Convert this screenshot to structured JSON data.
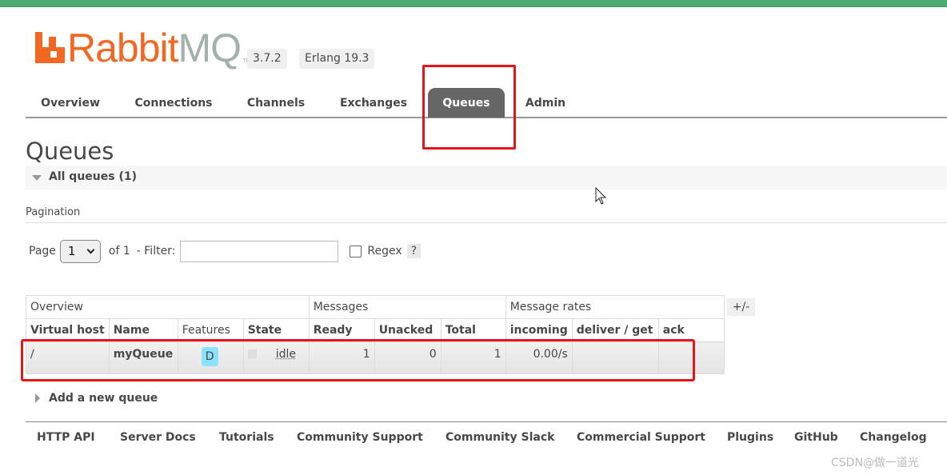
{
  "brand": {
    "name_rabbit": "Rabbit",
    "name_mq": "MQ",
    "trademark": "TM",
    "version": "3.7.2",
    "erlang": "Erlang 19.3",
    "accent_color": "#f26822",
    "topbar_color": "#4caa72"
  },
  "nav": {
    "tabs": [
      {
        "label": "Overview",
        "active": false
      },
      {
        "label": "Connections",
        "active": false
      },
      {
        "label": "Channels",
        "active": false
      },
      {
        "label": "Exchanges",
        "active": false
      },
      {
        "label": "Queues",
        "active": true
      },
      {
        "label": "Admin",
        "active": false
      }
    ]
  },
  "page": {
    "title": "Queues",
    "section_label": "All queues (1)",
    "pagination_title": "Pagination"
  },
  "pagination": {
    "page_label": "Page",
    "page_value": "1",
    "of_label": "of 1",
    "filter_label": "- Filter:",
    "filter_value": "",
    "regex_label": "Regex",
    "regex_checked": false,
    "help_label": "?"
  },
  "table": {
    "groups": [
      "Overview",
      "Messages",
      "Message rates"
    ],
    "columns": [
      "Virtual host",
      "Name",
      "Features",
      "State",
      "Ready",
      "Unacked",
      "Total",
      "incoming",
      "deliver / get",
      "ack"
    ],
    "rows": [
      {
        "vhost": "/",
        "name": "myQueue",
        "feature": "D",
        "state": "idle",
        "ready": "1",
        "unacked": "0",
        "total": "1",
        "incoming": "0.00/s",
        "deliver_get": "",
        "ack": ""
      }
    ],
    "toggle_columns_label": "+/-"
  },
  "add_queue": {
    "label": "Add a new queue"
  },
  "footer": {
    "links": [
      "HTTP API",
      "Server Docs",
      "Tutorials",
      "Community Support",
      "Community Slack",
      "Commercial Support",
      "Plugins",
      "GitHub",
      "Changelog"
    ]
  },
  "watermark": "CSDN@做一道光",
  "highlight_color": "#e8141a"
}
